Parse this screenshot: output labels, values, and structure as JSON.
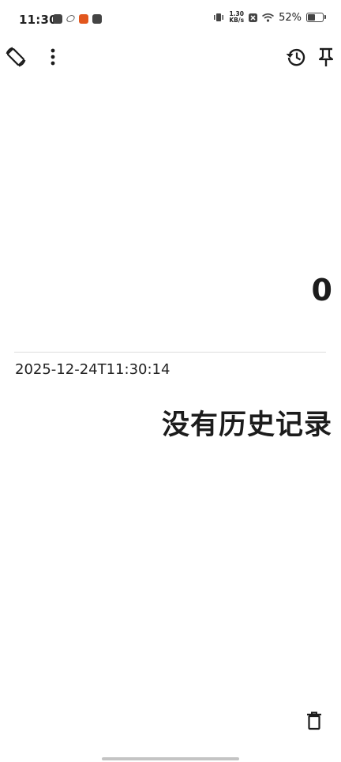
{
  "status_bar": {
    "time": "11:30",
    "net_speed_value": "1.30",
    "net_speed_unit": "KB/s",
    "battery": "52%",
    "battery_level": 0.52,
    "icons": [
      "calendar-icon",
      "link-icon",
      "app-icon",
      "mail-icon",
      "vibrate-icon",
      "x-icon",
      "wifi-icon",
      "battery-icon"
    ]
  },
  "toolbar": {
    "left_icons": [
      "screen-rotate-icon",
      "more-vert-icon"
    ],
    "right_icons": [
      "history-icon",
      "pin-icon"
    ]
  },
  "display": {
    "result": "0"
  },
  "history": {
    "timestamp": "2025-12-24T11:30:14",
    "empty_message": "没有历史记录"
  },
  "bottom": {
    "icons": [
      "delete-icon"
    ]
  },
  "colors": {
    "background": "#ffffff",
    "text": "#1c1c1c",
    "divider": "#dcdcdc",
    "accent_orange": "#e2571e"
  }
}
